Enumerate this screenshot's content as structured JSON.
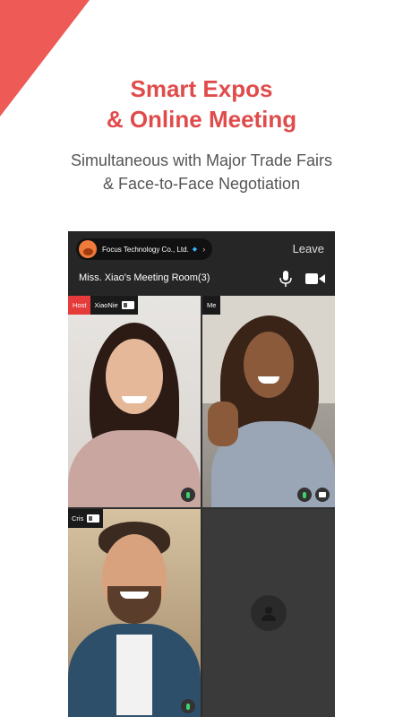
{
  "headline": {
    "line1": "Smart Expos",
    "line2": "& Online Meeting"
  },
  "subheading": {
    "line1": "Simultaneous with Major Trade Fairs",
    "line2": "& Face-to-Face Negotiation"
  },
  "meeting": {
    "company_name": "Focus Technology Co., Ltd.",
    "leave_label": "Leave",
    "room_title": "Miss. Xiao's Meeting Room(3)"
  },
  "participants": [
    {
      "role_label": "Host",
      "name": "XiaoNie"
    },
    {
      "role_label": "Me"
    },
    {
      "name": "Cris"
    }
  ],
  "colors": {
    "accent": "#e04b4b",
    "corner": "#ee5a55",
    "host_badge": "#e53b3b",
    "mic_active": "#3fd36b"
  }
}
